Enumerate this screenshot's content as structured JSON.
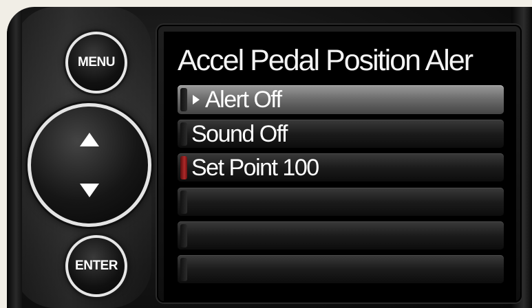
{
  "device": {
    "menu_button_label": "MENU",
    "enter_button_label": "ENTER",
    "up_icon": "arrow-up-icon",
    "down_icon": "arrow-down-icon"
  },
  "screen": {
    "title": "Accel Pedal Position Aler",
    "rows": [
      {
        "label": "Alert Off",
        "selected": true,
        "marker_color": ""
      },
      {
        "label": "Sound Off",
        "selected": false,
        "marker_color": ""
      },
      {
        "label": "Set Point 100",
        "selected": false,
        "marker_color": "#b02a2a"
      },
      {
        "label": "",
        "selected": false,
        "marker_color": ""
      },
      {
        "label": "",
        "selected": false,
        "marker_color": ""
      },
      {
        "label": "",
        "selected": false,
        "marker_color": ""
      }
    ]
  },
  "colors": {
    "highlight_row": "#8a8a8a",
    "accent_red": "#b02a2a",
    "text": "#ffffff"
  }
}
